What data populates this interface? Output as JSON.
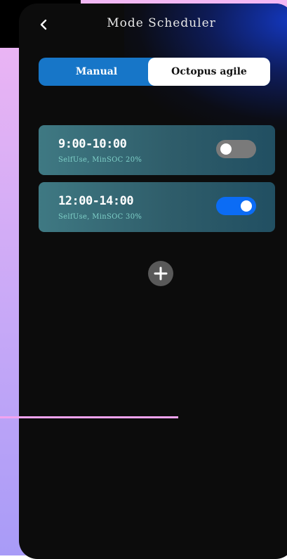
{
  "header": {
    "title": "Mode Scheduler",
    "back_icon": "chevron-left-icon"
  },
  "segmented": {
    "manual_label": "Manual",
    "octopus_label": "Octopus agile",
    "selected": "Octopus agile"
  },
  "schedules": [
    {
      "time": "9:00-10:00",
      "description": "SelfUse, MinSOC 20%",
      "enabled": false
    },
    {
      "time": "12:00-14:00",
      "description": "SelfUse, MinSOC 30%",
      "enabled": true
    }
  ],
  "add_icon": "plus-icon",
  "colors": {
    "accent_blue": "#0b6cf5",
    "segment_blue": "#1776c8",
    "card_teal": "#3f7983",
    "toggle_off": "#7a7a7a",
    "background": "#0c0c0c"
  }
}
